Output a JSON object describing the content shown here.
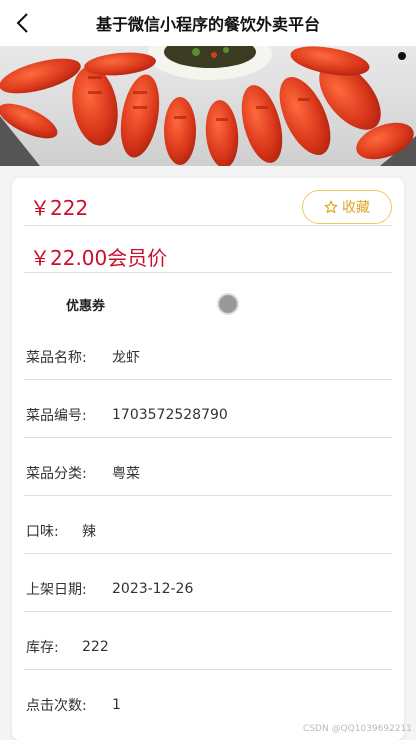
{
  "header": {
    "title": "基于微信小程序的餐饮外卖平台"
  },
  "product": {
    "price": "￥222",
    "favorite_label": "收藏",
    "member_price": "￥22.00会员价",
    "coupon_label": "优惠券"
  },
  "details": [
    {
      "label": "菜品名称:",
      "value": "龙虾"
    },
    {
      "label": "菜品编号:",
      "value": "1703572528790"
    },
    {
      "label": "菜品分类:",
      "value": "粤菜"
    },
    {
      "label": "口味:",
      "value": "辣"
    },
    {
      "label": "上架日期:",
      "value": "2023-12-26"
    },
    {
      "label": "库存:",
      "value": "222"
    },
    {
      "label": "点击次数:",
      "value": "1"
    }
  ],
  "watermark": "CSDN @QQ1039692211",
  "colors": {
    "price": "#c8102e",
    "favorite": "#e0a526"
  }
}
